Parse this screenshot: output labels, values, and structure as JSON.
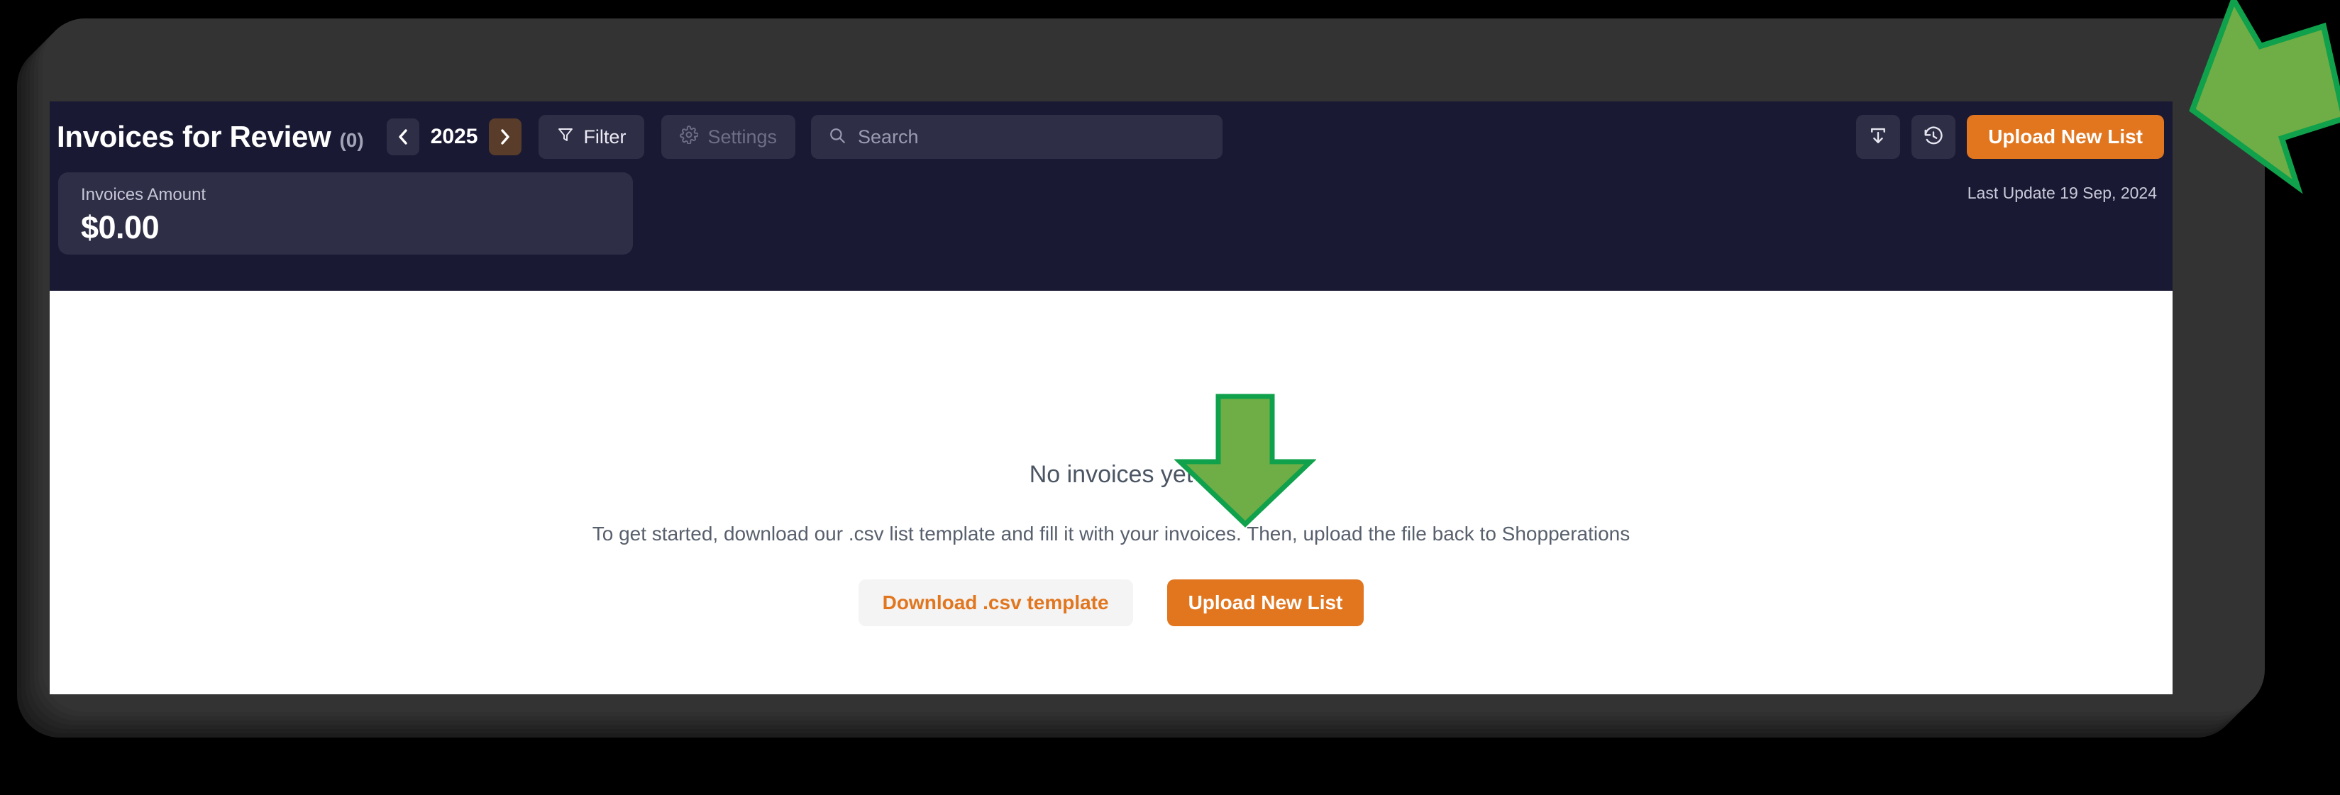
{
  "header": {
    "title": "Invoices for Review",
    "count": "(0)",
    "year": "2025",
    "prev_icon": "chevron-left-icon",
    "next_icon": "chevron-right-icon",
    "filter_label": "Filter",
    "filter_icon": "funnel-icon",
    "settings_label": "Settings",
    "settings_icon": "gear-icon",
    "search_placeholder": "Search",
    "search_value": "",
    "search_icon": "search-icon",
    "download_icon": "download-tray-icon",
    "history_icon": "history-clock-icon",
    "upload_label": "Upload New List"
  },
  "stats": {
    "invoices_amount_label": "Invoices Amount",
    "invoices_amount_value": "$0.00",
    "last_update": "Last Update 19 Sep, 2024"
  },
  "empty_state": {
    "title": "No invoices yet",
    "description": "To get started, download our .csv list template and fill it with your invoices. Then, upload the file back to Shopperations",
    "download_label": "Download .csv template",
    "upload_label": "Upload New List"
  },
  "annotations": [
    {
      "name": "arrow-center",
      "direction": "down",
      "fill": "#6FAD46",
      "stroke": "#0FA14B"
    },
    {
      "name": "arrow-corner",
      "direction": "down-left",
      "fill": "#6FAD46",
      "stroke": "#0FA14B"
    }
  ],
  "colors": {
    "accent": "#e1761f",
    "header_bg": "#191933",
    "card_bg": "#2e2e46",
    "content_bg": "#ffffff",
    "frame": "#333333"
  }
}
